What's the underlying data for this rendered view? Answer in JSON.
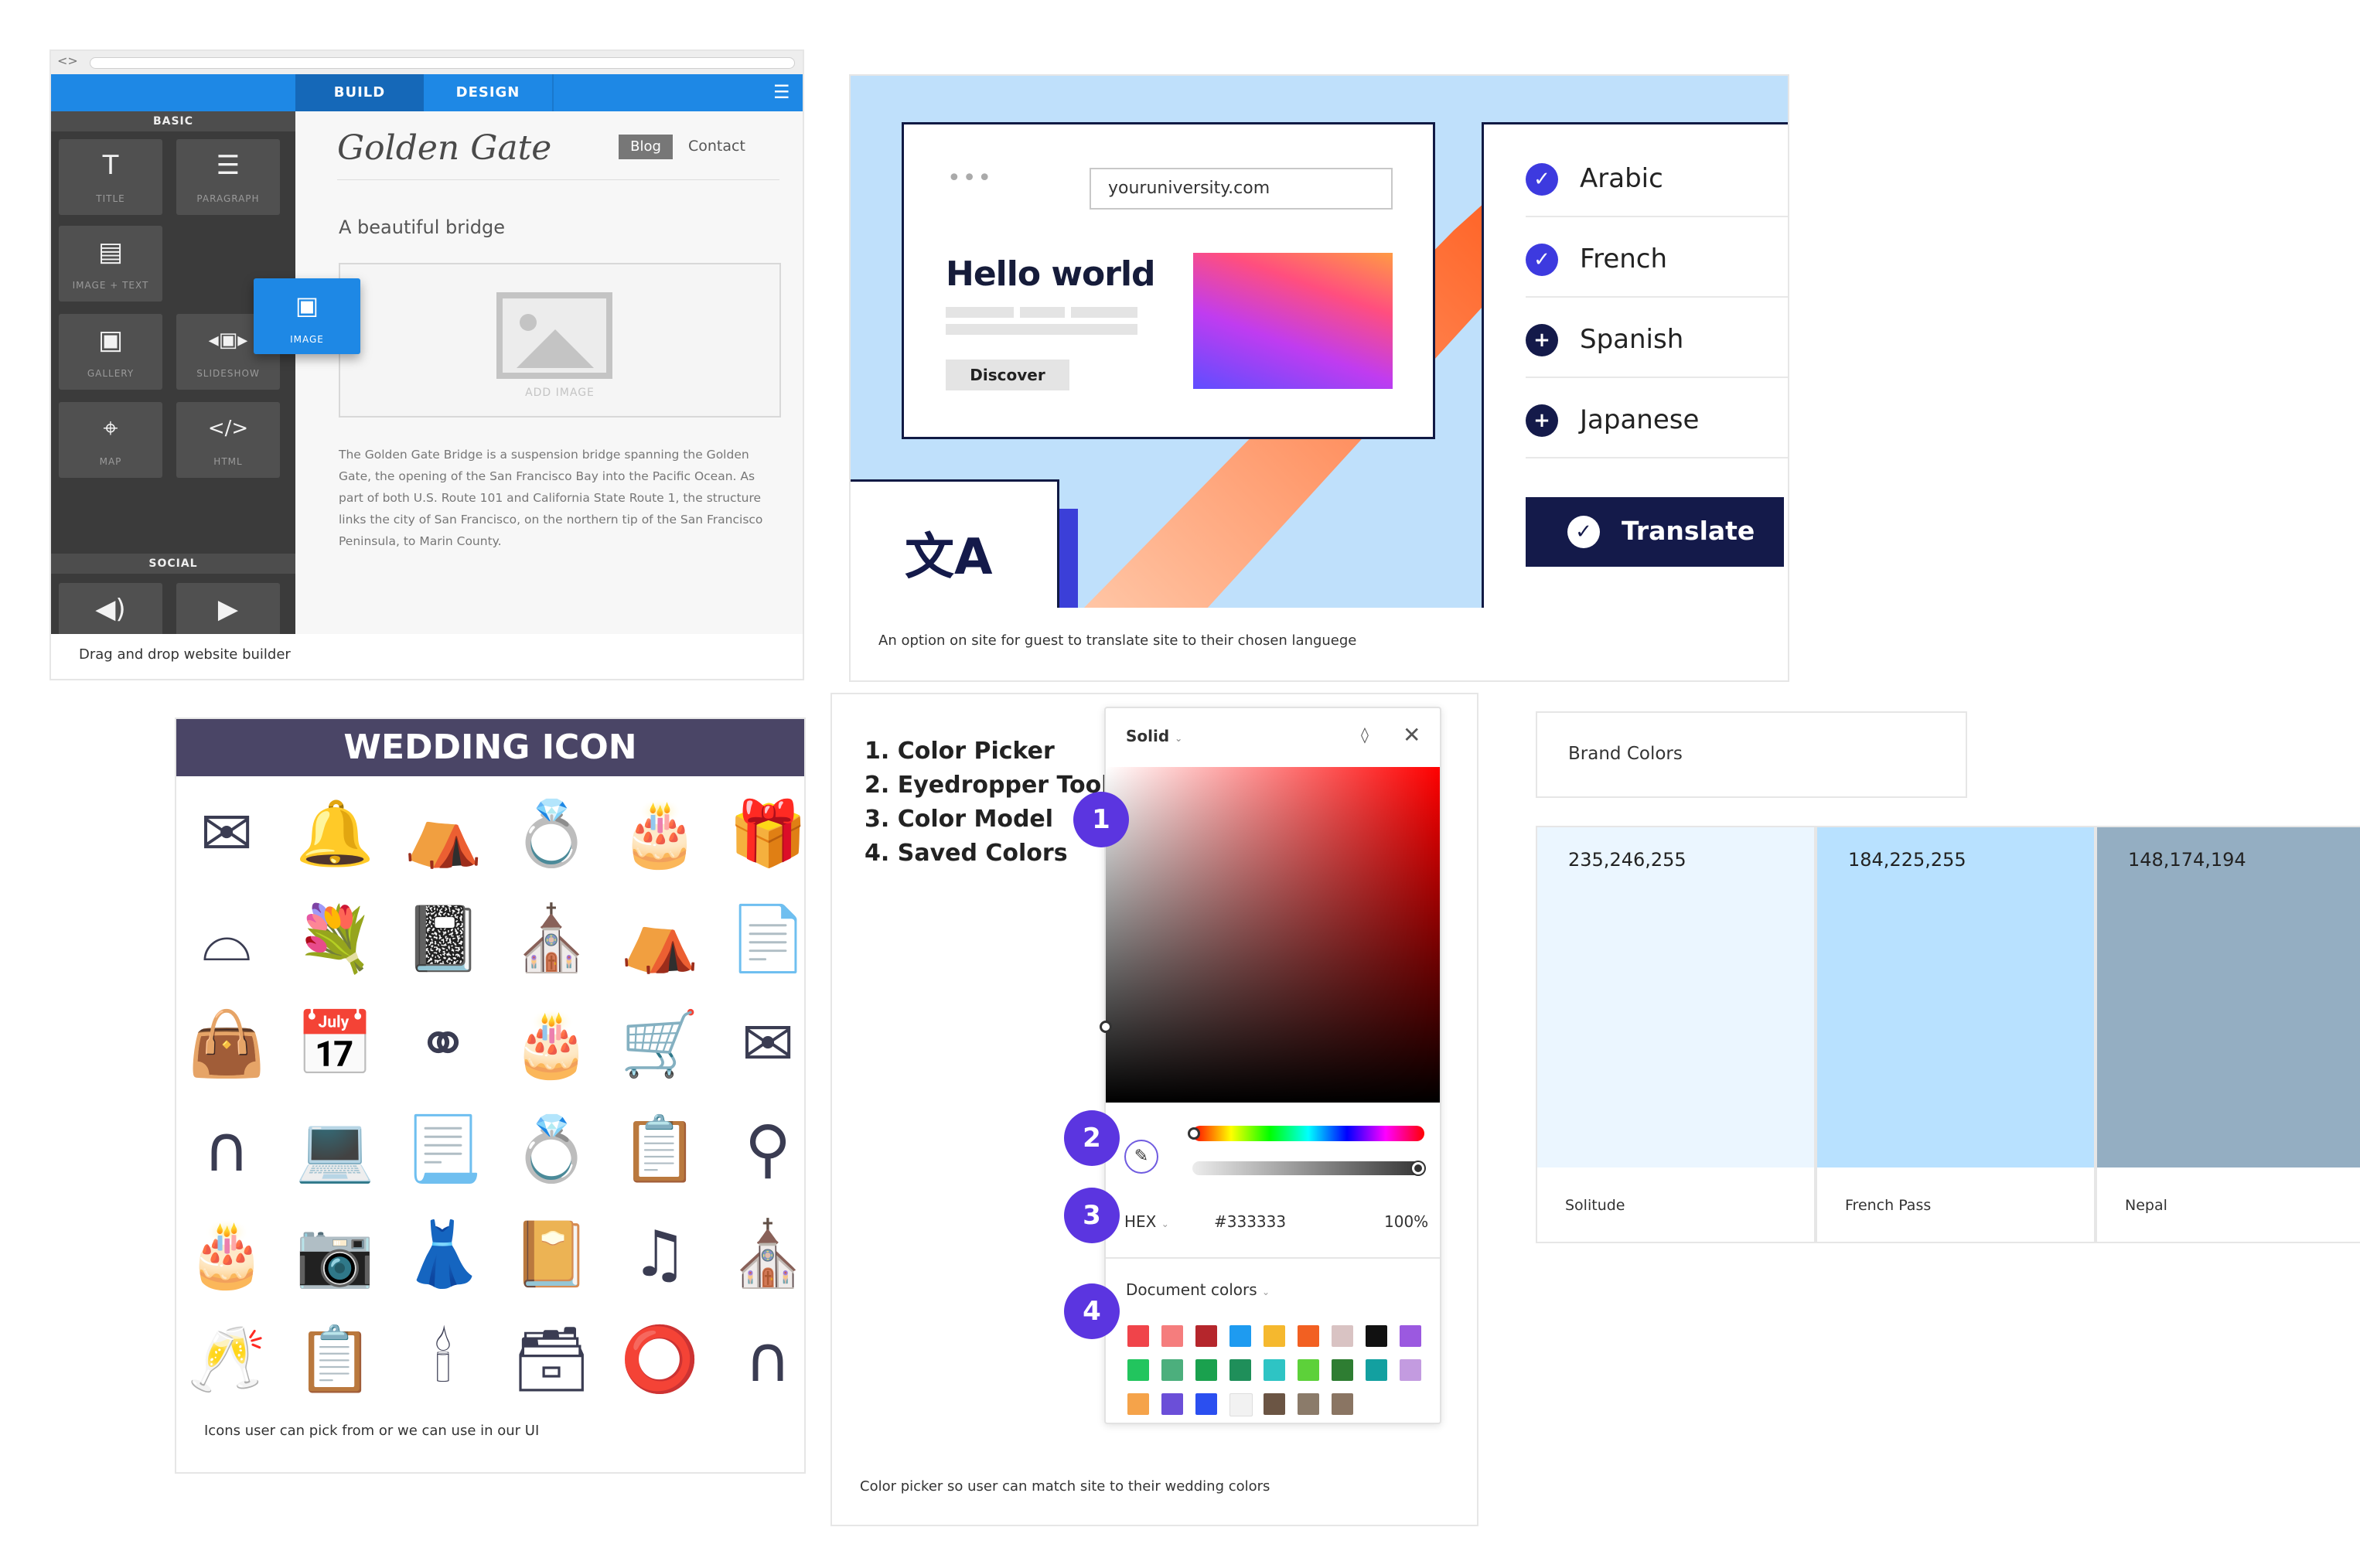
{
  "builder": {
    "tabs": [
      "BUILD",
      "DESIGN"
    ],
    "sections": {
      "basic": "BASIC",
      "social": "SOCIAL"
    },
    "tiles": [
      {
        "label": "TITLE",
        "icon": "title-icon",
        "glyph": "T"
      },
      {
        "label": "PARAGRAPH",
        "icon": "paragraph-icon",
        "glyph": "☰"
      },
      {
        "label": "IMAGE + TEXT",
        "icon": "image-text-icon",
        "glyph": "▤"
      },
      {
        "label": "GALLERY",
        "icon": "gallery-icon",
        "glyph": "▣"
      },
      {
        "label": "SLIDESHOW",
        "icon": "slideshow-icon",
        "glyph": "◂▣▸"
      },
      {
        "label": "MAP",
        "icon": "map-pin-icon",
        "glyph": "⌖"
      },
      {
        "label": "HTML",
        "icon": "code-icon",
        "glyph": "</>"
      }
    ],
    "dragging_tile": {
      "label": "IMAGE",
      "icon": "image-icon",
      "glyph": "▣"
    },
    "social_icons": [
      {
        "icon": "audio-icon",
        "glyph": "◀)"
      },
      {
        "icon": "video-icon",
        "glyph": "▶"
      }
    ],
    "site_logo": "Golden Gate",
    "nav": {
      "blog": "Blog",
      "contact": "Contact"
    },
    "subtitle": "A beautiful bridge",
    "add_image": "ADD IMAGE",
    "paragraph": "The Golden Gate Bridge is a suspension bridge spanning the Golden Gate, the opening of the San Francisco Bay into the Pacific Ocean. As part of both U.S. Route 101 and California State Route 1, the structure links the city of San Francisco, on the northern tip of the San Francisco Peninsula, to Marin County.",
    "caption": "Drag and drop website builder"
  },
  "translate": {
    "url": "youruniversity.com",
    "hello": "Hello world",
    "discover": "Discover",
    "languages": [
      {
        "name": "Arabic",
        "selected": true
      },
      {
        "name": "French",
        "selected": true
      },
      {
        "name": "Spanish",
        "selected": false
      },
      {
        "name": "Japanese",
        "selected": false
      }
    ],
    "button": "Translate",
    "glyph": "文A",
    "caption": "An option on site for guest to translate site to their chosen languege"
  },
  "wedding": {
    "title": "WEDDING ICON",
    "icons": [
      [
        "rsvp-icon",
        "✉"
      ],
      [
        "wedding-bells-icon",
        "🔔"
      ],
      [
        "dinner-table-icon",
        "⛺"
      ],
      [
        "rings-icon",
        "💍"
      ],
      [
        "wedding-cake-icon",
        "🎂"
      ],
      [
        "gift-box-icon",
        "🎁"
      ],
      [
        "cake-stand-icon",
        "⌓"
      ],
      [
        "bouquet-icon",
        "💐"
      ],
      [
        "notebook-icon",
        "📓"
      ],
      [
        "chapel-arch-icon",
        "⛪"
      ],
      [
        "banquet-table-icon",
        "⛺"
      ],
      [
        "certificate-icon",
        "📄"
      ],
      [
        "gift-bag-icon",
        "👜"
      ],
      [
        "calendar-icon",
        "📅"
      ],
      [
        "ring-pair-icon",
        "⚭"
      ],
      [
        "tiered-cake-icon",
        "🎂"
      ],
      [
        "carriage-icon",
        "🛒"
      ],
      [
        "invitation-icon",
        "✉"
      ],
      [
        "flower-arch-icon",
        "∩"
      ],
      [
        "wedding-laptop-icon",
        "💻"
      ],
      [
        "love-letter-icon",
        "📃"
      ],
      [
        "diamond-ring-icon",
        "💍"
      ],
      [
        "checklist-icon",
        "📋"
      ],
      [
        "table-centerpiece-icon",
        "⚲"
      ],
      [
        "heart-cake-icon",
        "🎂"
      ],
      [
        "photographer-icon",
        "📷"
      ],
      [
        "wedding-dress-icon",
        "👗"
      ],
      [
        "guest-book-icon",
        "📔"
      ],
      [
        "music-notes-icon",
        "♫"
      ],
      [
        "church-icon",
        "⛪"
      ],
      [
        "toast-glasses-icon",
        "🥂"
      ],
      [
        "schedule-clipboard-icon",
        "📋"
      ],
      [
        "candle-icon",
        "🕯"
      ],
      [
        "ring-box-icon",
        "🗃"
      ],
      [
        "ring-plate-icon",
        "⭕"
      ],
      [
        "garden-arch-icon",
        "∩"
      ]
    ],
    "caption": "Icons user can pick from or we can use in our UI"
  },
  "picker": {
    "list": [
      "1. Color Picker",
      "2. Eyedropper Tool",
      "3. Color Model",
      "4. Saved Colors"
    ],
    "fill_type": "Solid",
    "model": "HEX",
    "hex": "#333333",
    "opacity": "100%",
    "document_colors": "Document colors",
    "markers": [
      "1",
      "2",
      "3",
      "4"
    ],
    "swatches": [
      [
        "#f0444a",
        "#f57d7d",
        "#b5262c",
        "#1e9bf0",
        "#f5b82e",
        "#f26022",
        "#d9c3c3",
        "#111111",
        "#9b59e0"
      ],
      [
        "#22c55e",
        "#4caf7d",
        "#1aa14e",
        "#1f8f5a",
        "#2ec4c4",
        "#5dd13a",
        "#2e7d32",
        "#13a0a0",
        "#c39be0"
      ],
      [
        "#f5a34a",
        "#6b4fd8",
        "#2b4ff0",
        "#f2f2f2",
        "#6b5544",
        "#8b7b6a",
        "#8a7563"
      ]
    ],
    "caption": "Color picker so user can match site to their wedding colors"
  },
  "brand": {
    "title": "Brand Colors",
    "colors": [
      {
        "rgb": "235,246,255",
        "hex": "#ebf6ff",
        "name": "Solitude"
      },
      {
        "rgb": "184,225,255",
        "hex": "#b8e1ff",
        "name": "French Pass"
      },
      {
        "rgb": "148,174,194",
        "hex": "#94aec2",
        "name": "Nepal"
      }
    ]
  }
}
